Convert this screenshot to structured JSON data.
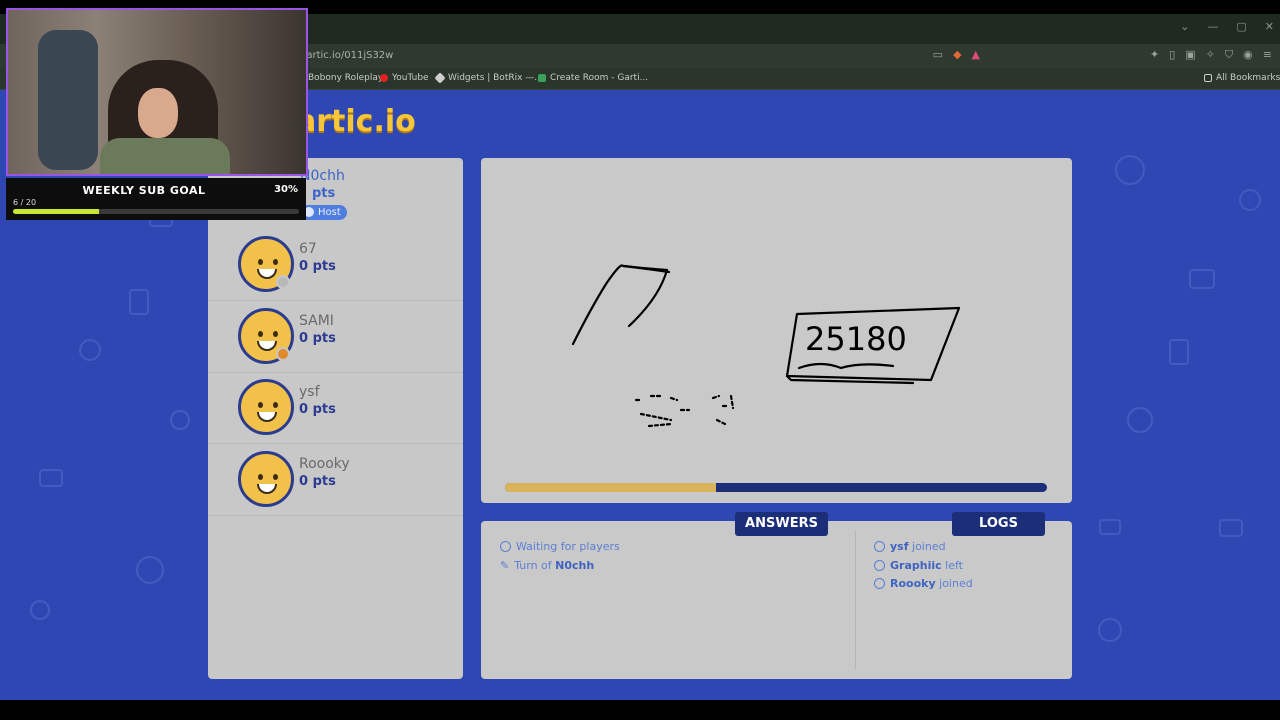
{
  "browser": {
    "url": "gartic.io/011jS32w",
    "window_controls": [
      "⌄",
      "—",
      "▢",
      "✕"
    ],
    "toolbar_icons": [
      "cast-icon",
      "brave-shield-icon",
      "rewards-icon",
      "extensions-icon",
      "sidebar-icon",
      "wallet-icon",
      "vpn-icon",
      "menu-icon"
    ],
    "bookmarks": [
      {
        "label": "Bobony Roleplay",
        "color": "#8a5cf0"
      },
      {
        "label": "YouTube",
        "color": "#e02222"
      },
      {
        "label": "Widgets | BotRix —...",
        "color": "#cfcfcf"
      },
      {
        "label": "Create Room - Garti...",
        "color": "#3aa05a"
      }
    ],
    "all_bookmarks": "All Bookmarks"
  },
  "game": {
    "logo": "artic.io",
    "players": [
      {
        "name": "N0chh",
        "pts": "pts",
        "host_label": "Host"
      },
      {
        "name": "67",
        "pts": "0 pts",
        "status_color": "#b8b8b8"
      },
      {
        "name": "SAMI",
        "pts": "0 pts",
        "status_color": "#e08a2c"
      },
      {
        "name": "ysf",
        "pts": "0 pts"
      },
      {
        "name": "Roooky",
        "pts": "0 pts"
      }
    ],
    "timer_progress": 0.39,
    "answers_tab": "ANSWERS",
    "logs_tab": "LOGS",
    "answers": [
      {
        "text": "Waiting for players",
        "icon": "info-icon"
      },
      {
        "prefix": "Turn of ",
        "name": "N0chh",
        "icon": "pencil-icon"
      }
    ],
    "logs": [
      {
        "name": "ysf",
        "text": " joined"
      },
      {
        "name": "Graphiic",
        "text": " left"
      },
      {
        "name": "Roooky",
        "text": " joined"
      }
    ],
    "drawing_text": "25180"
  },
  "overlay": {
    "goal_title": "WEEKLY SUB GOAL",
    "goal_percent": "30%",
    "goal_count": "6 / 20",
    "goal_fraction": 0.3
  }
}
